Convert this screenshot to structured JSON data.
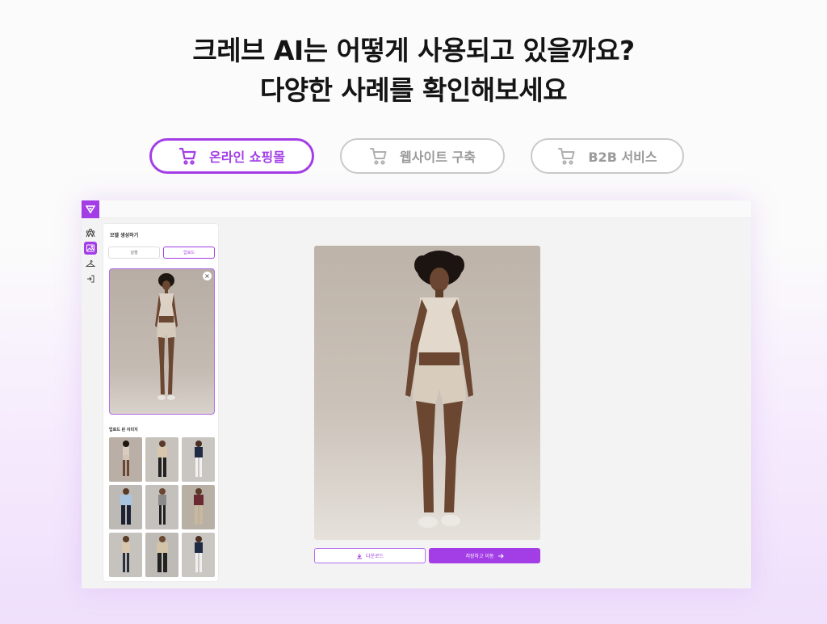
{
  "headline": {
    "line1": "크레브 AI는 어떻게 사용되고 있을까요?",
    "line2": "다양한 사례를 확인해보세요"
  },
  "tabs": [
    {
      "label": "온라인 쇼핑몰",
      "icon": "cart-icon",
      "active": true
    },
    {
      "label": "웹사이트 구축",
      "icon": "cart-icon",
      "active": false
    },
    {
      "label": "B2B 서비스",
      "icon": "cart-icon",
      "active": false
    }
  ],
  "colors": {
    "accent": "#a33ee6",
    "inactive": "#9a9a9a"
  },
  "app": {
    "rail": [
      "models-icon",
      "image-icon",
      "hanger-icon",
      "exit-icon"
    ],
    "panel": {
      "title": "모델 생성하기",
      "segments": [
        "실행",
        "업로드"
      ],
      "uploaded_label": "업로드 된 이미지",
      "close": "×"
    },
    "buttons": {
      "download": "다운로드",
      "save": "저장하고 이동"
    }
  }
}
